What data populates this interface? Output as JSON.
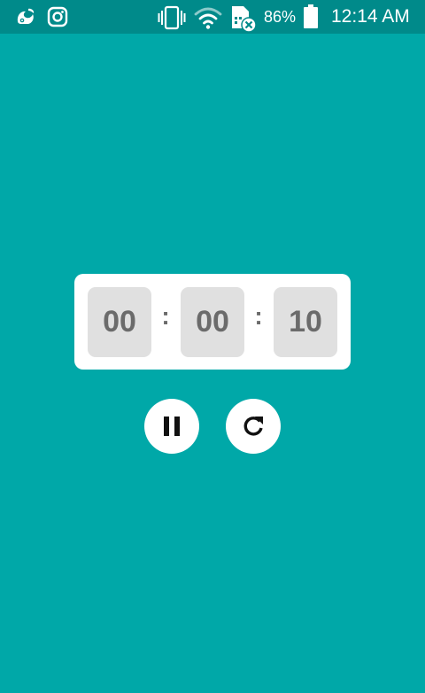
{
  "status_bar": {
    "left_icons": [
      "uc-browser-icon",
      "instagram-icon"
    ],
    "right_icons": [
      "vibrate-icon",
      "wifi-icon",
      "sim-card-off-icon",
      "battery-icon"
    ],
    "battery_percent": "86%",
    "time": "12:14 AM"
  },
  "timer": {
    "hours": "00",
    "minutes": "00",
    "seconds": "10",
    "separator": ":"
  },
  "controls": {
    "pause_icon": "pause-icon",
    "reset_icon": "refresh-icon"
  },
  "colors": {
    "background": "#00A8A8",
    "status_bar": "#008A8A",
    "card": "#FFFFFF",
    "digit_box": "#E0E0E0",
    "digit_text": "#6B6B6B"
  }
}
